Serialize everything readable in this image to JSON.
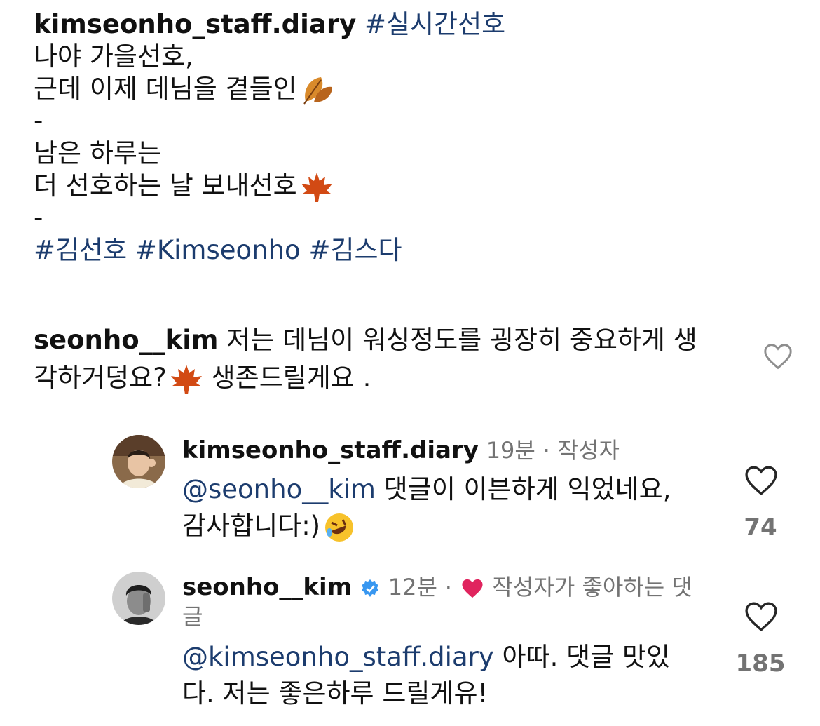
{
  "caption": {
    "username": "kimseonho_staff.diary",
    "hashtag": "#실시간선호",
    "line1": "나야 가을선호,",
    "line2": "근데 이제 데님을 곁들인",
    "line3": "-",
    "line4": "남은 하루는",
    "line5": "더 선호하는 날 보내선호",
    "line6": "-",
    "tags": [
      "#김선호",
      "#Kimseonho",
      "#김스다"
    ]
  },
  "comment": {
    "username": "seonho__kim",
    "text1": "저는 데님이 워싱정도를 굉장히 중요하게 생",
    "text2": "각하거덩요?",
    "text3": "생존드릴게요 ."
  },
  "replies": [
    {
      "username": "kimseonho_staff.diary",
      "time": "19분",
      "badge": "작성자",
      "mention": "@seonho__kim",
      "text1": "댓글이 이븐하게 익었네요,",
      "text2": "감사합니다:)",
      "likes": "74"
    },
    {
      "username": "seonho__kim",
      "time": "12분",
      "badge1": "작성자가 좋아하는 댓",
      "badge2": "글",
      "mention": "@kimseonho_staff.diary",
      "text1": "아따. 댓글 맛있",
      "text2": "다. 저는 좋은하루 드릴게유!",
      "likes": "185"
    }
  ],
  "colors": {
    "tag": "#1c3c6e",
    "meta": "#737373",
    "heart": "#e0245e",
    "verified": "#3897f0"
  }
}
